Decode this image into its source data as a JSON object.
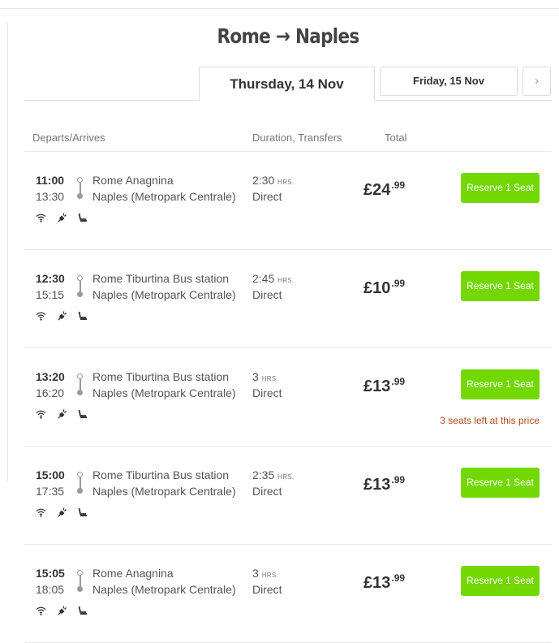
{
  "route": {
    "title": "Rome → Naples"
  },
  "date_tabs": {
    "active": "Thursday, 14 Nov",
    "next": "Friday, 15 Nov",
    "arrow": "›"
  },
  "columns": {
    "departs_arrives": "Departs/Arrives",
    "duration_transfers": "Duration, Transfers",
    "total": "Total"
  },
  "labels": {
    "hrs": "HRS.",
    "reserve": "Reserve 1 Seat"
  },
  "colors": {
    "accent_green": "#73d700",
    "warning_text": "#b5461c"
  },
  "amenity_icons": [
    "wifi-icon",
    "power-plug-icon",
    "seat-icon"
  ],
  "trips": [
    {
      "depart": "11:00",
      "arrive": "13:30",
      "from": "Rome Anagnina",
      "to": "Naples (Metropark Centrale)",
      "duration": "2:30",
      "transfers": "Direct",
      "price_main": "£24",
      "price_decimal": ".99",
      "note": ""
    },
    {
      "depart": "12:30",
      "arrive": "15:15",
      "from": "Rome Tiburtina Bus station",
      "to": "Naples (Metropark Centrale)",
      "duration": "2:45",
      "transfers": "Direct",
      "price_main": "£10",
      "price_decimal": ".99",
      "note": ""
    },
    {
      "depart": "13:20",
      "arrive": "16:20",
      "from": "Rome Tiburtina Bus station",
      "to": "Naples (Metropark Centrale)",
      "duration": "3",
      "transfers": "Direct",
      "price_main": "£13",
      "price_decimal": ".99",
      "note": "3 seats left at this price"
    },
    {
      "depart": "15:00",
      "arrive": "17:35",
      "from": "Rome Tiburtina Bus station",
      "to": "Naples (Metropark Centrale)",
      "duration": "2:35",
      "transfers": "Direct",
      "price_main": "£13",
      "price_decimal": ".99",
      "note": ""
    },
    {
      "depart": "15:05",
      "arrive": "18:05",
      "from": "Rome Anagnina",
      "to": "Naples (Metropark Centrale)",
      "duration": "3",
      "transfers": "Direct",
      "price_main": "£13",
      "price_decimal": ".99",
      "note": ""
    }
  ]
}
